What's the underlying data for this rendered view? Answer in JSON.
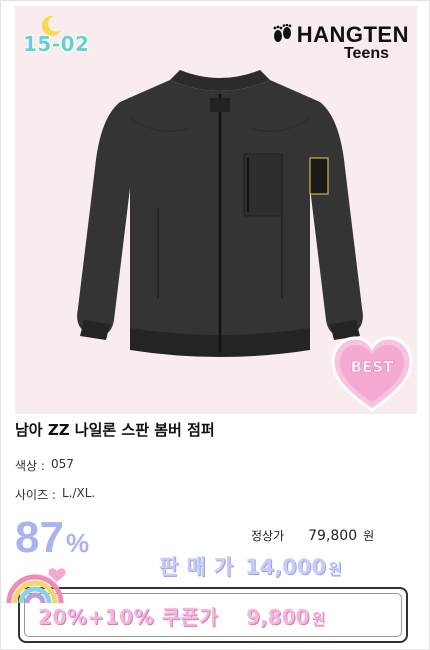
{
  "image": {
    "code_badge": "15-02",
    "brand": {
      "name": "HANGTEN",
      "sub": "Teens"
    },
    "best_badge": "BEST"
  },
  "product": {
    "title": "남아 ZZ 나일론 스판 봄버 점퍼",
    "color_label": "색상 :",
    "color_value": "057",
    "size_label": "사이즈 :",
    "size_value": "L./XL."
  },
  "pricing": {
    "discount_number": "87",
    "discount_percent": "%",
    "regular_label": "정상가",
    "regular_value": "79,800",
    "regular_unit": "원",
    "sale_label": "판매가",
    "sale_value": "14,000",
    "sale_unit": "원",
    "coupon_label": "20%+10% 쿠폰가",
    "coupon_value": "9,800",
    "coupon_unit": "원"
  },
  "colors": {
    "discount": "#a9b4ef",
    "sale": "#c7cdf5",
    "coupon": "#f5b6dd",
    "image_bg": "#f8ecee",
    "code_badge": "#6ad0cf"
  },
  "icons": [
    "moon-icon",
    "footprints-icon",
    "heart-best-icon",
    "rainbow-icon"
  ]
}
